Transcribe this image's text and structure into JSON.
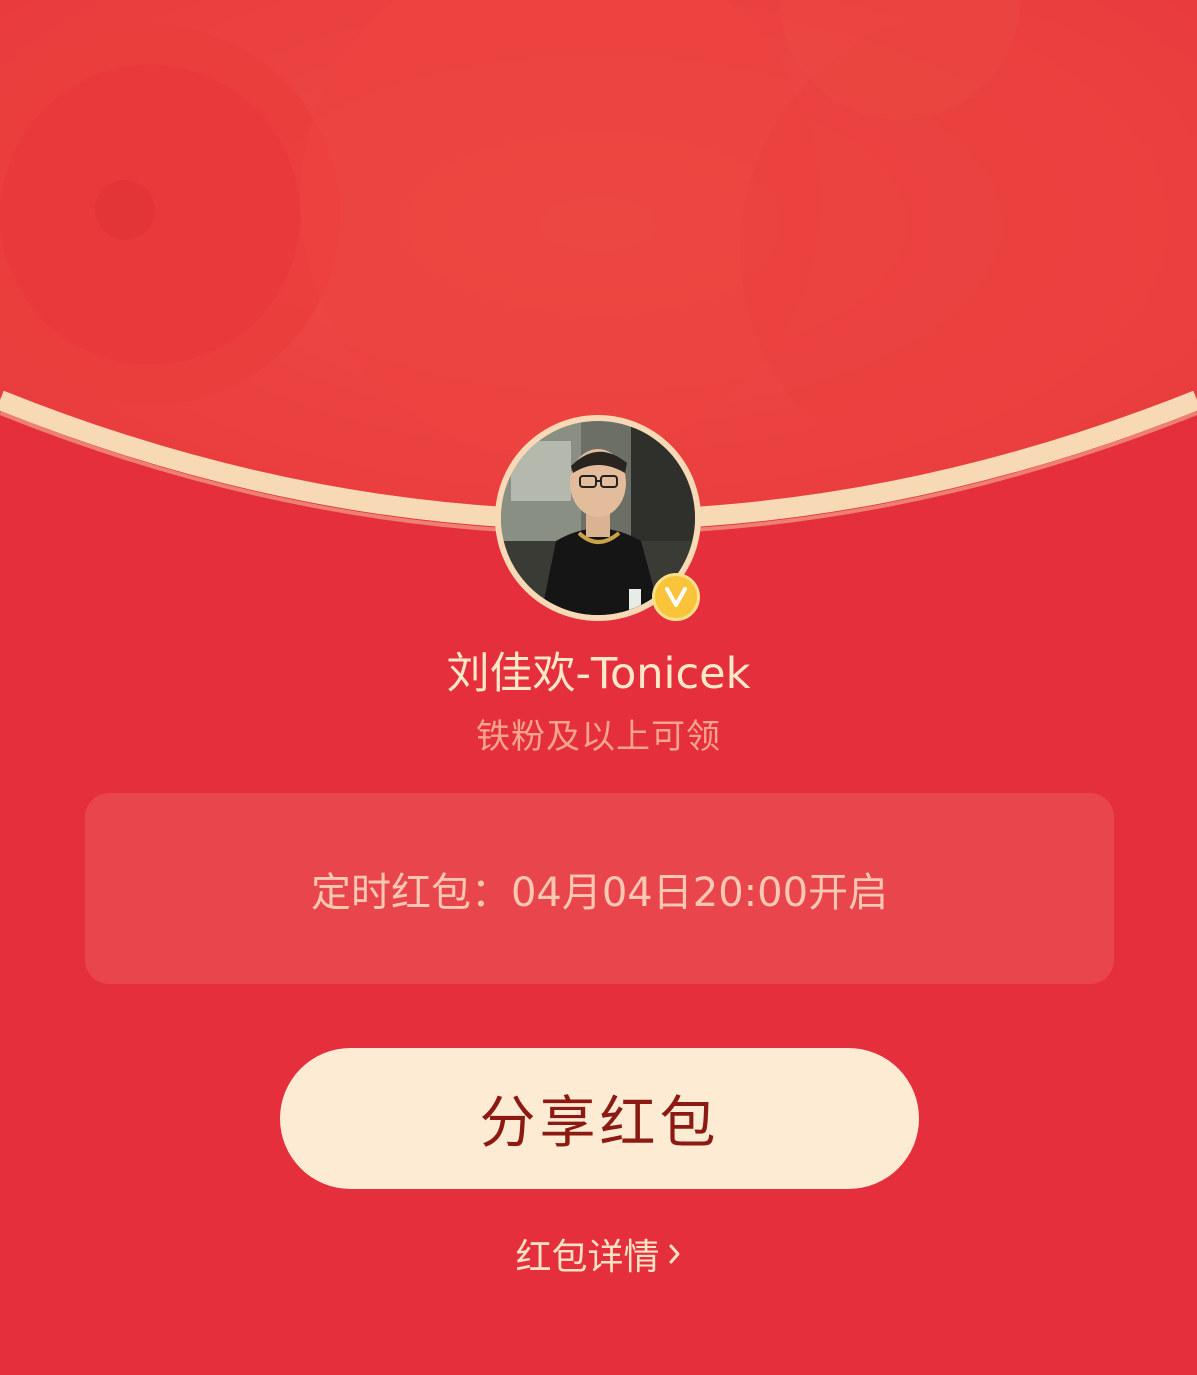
{
  "header": {
    "background_color": "#e9393e",
    "arc_color": "#f8d9b6"
  },
  "profile": {
    "avatar_alt": "avatar",
    "verified_icon": "verified-v-icon",
    "username": "刘佳欢-Tonicek",
    "eligibility": "铁粉及以上可领"
  },
  "timer": {
    "text": "定时红包：04月04日20:00开启"
  },
  "actions": {
    "share_label": "分享红包",
    "details_label": "红包详情",
    "details_icon": "chevron-right-icon"
  },
  "colors": {
    "page_background": "#e52f3c",
    "button_background": "#fdebd3",
    "button_text": "#8c1a12",
    "accent_gold": "#f9c33a"
  }
}
